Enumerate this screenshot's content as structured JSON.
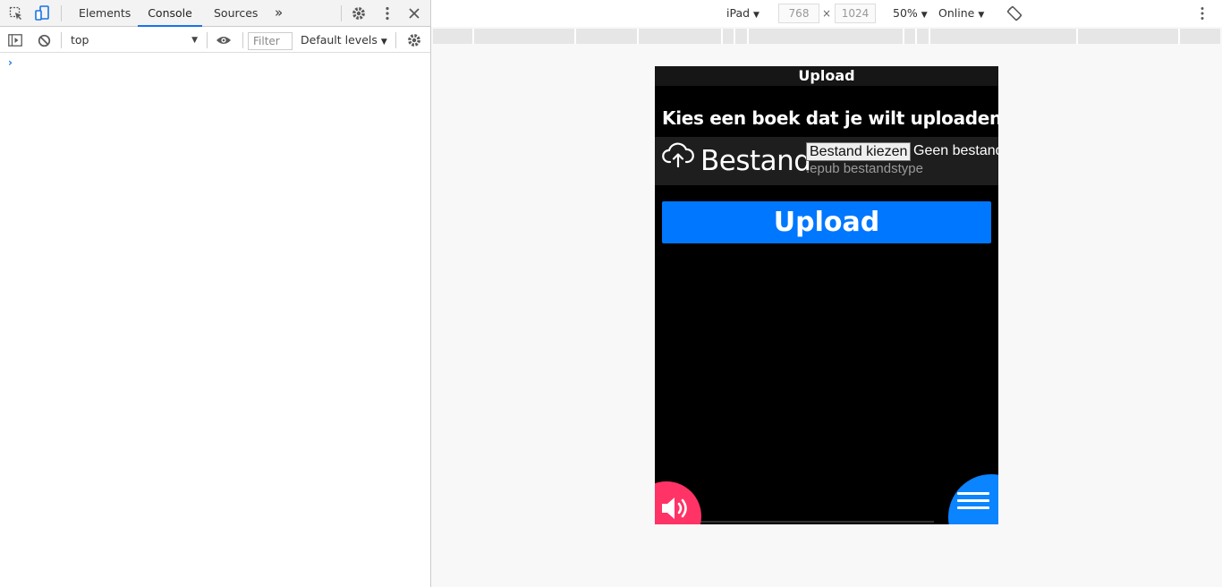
{
  "devtools": {
    "tabs": [
      "Elements",
      "Console",
      "Sources"
    ],
    "active_tab": "Console",
    "more_tabs": "»",
    "console_context": "top",
    "filter_placeholder": "Filter",
    "log_levels": "Default levels",
    "prompt": "›"
  },
  "device_toolbar": {
    "device": "iPad",
    "width": "768",
    "height": "1024",
    "times": "×",
    "zoom": "50%",
    "network": "Online"
  },
  "app": {
    "header_title": "Upload",
    "heading": "Kies een boek dat je wilt uploaden",
    "file_label": "Bestand",
    "choose_button": "Bestand kiezen",
    "no_file_text": "Geen bestand gekozen",
    "file_hint": ".epub bestandstype",
    "upload_button": "Upload",
    "colors": {
      "upload_button": "#0077ff",
      "speaker_fab": "#ff3366",
      "menu_fab": "#0a84ff"
    }
  }
}
